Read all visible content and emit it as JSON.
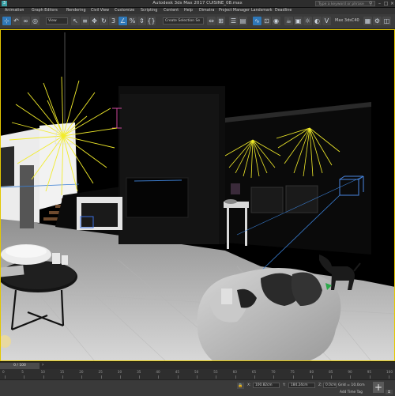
{
  "window": {
    "title": "Autodesk 3ds Max 2017    CUISINE_08.max",
    "search_placeholder": "Type a keyword or phrase"
  },
  "menu": [
    "Animation",
    "Graph Editors",
    "Rendering",
    "Civil View",
    "Customize",
    "Scripting",
    "Content",
    "Help",
    "Dimatra",
    "Project Manager",
    "Landsmark",
    "Deadline"
  ],
  "toolbar": {
    "filter_select": "View",
    "selection_set": "Create Selection Se",
    "workspace_label": "Max 3dsC40"
  },
  "timeline": {
    "position": "0 / 100",
    "ticks": [
      "0",
      "5",
      "10",
      "15",
      "20",
      "25",
      "30",
      "35",
      "40",
      "45",
      "50",
      "55",
      "60",
      "65",
      "70",
      "75",
      "80",
      "85",
      "90",
      "95",
      "100"
    ]
  },
  "status": {
    "x_value": "100.82cm",
    "y_value": "184.24cm",
    "z_value": "0.0cm",
    "grid": "Grid = 10.0cm",
    "add_time_tag": "Add Time Tag"
  },
  "colors": {
    "viewport_active_border": "#e4c800",
    "light_rays": "#f2ec2a",
    "active_tool": "#2f78b8"
  }
}
